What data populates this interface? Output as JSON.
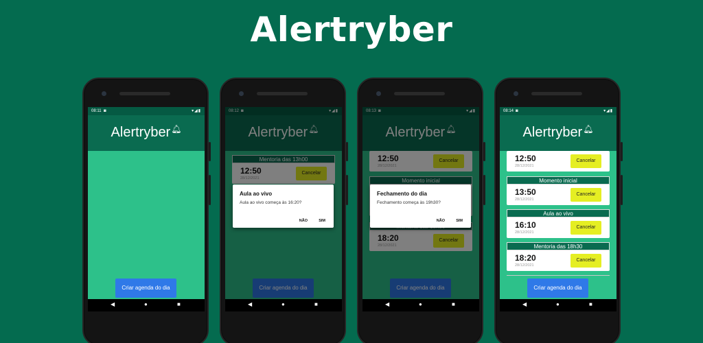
{
  "hero_title": "Alertryber",
  "colors": {
    "background": "#046b4f",
    "app_bar": "#0a6b50",
    "content": "#2dc18a",
    "cancel_button": "#e5ee23",
    "primary_button": "#2f79e8"
  },
  "phones": [
    {
      "status_time": "08:11",
      "app_title": "Alertryber",
      "create_button": "Criar agenda do dia"
    },
    {
      "status_time": "08:12",
      "app_title": "Alertryber",
      "cards": [
        {
          "header": "Mentoria das 13h00",
          "time": "12:50",
          "date": "28/12/2021",
          "cancel": "Cancelar"
        }
      ],
      "dialog": {
        "title": "Aula ao vivo",
        "message": "Aula ao vivo começa às 16:20?",
        "no": "NÃO",
        "yes": "SIM"
      },
      "create_button": "Criar agenda do dia"
    },
    {
      "status_time": "08:13",
      "app_title": "Alertryber",
      "cards": [
        {
          "time": "12:50",
          "date": "28/12/2021",
          "cancel": "Cancelar"
        },
        {
          "header": "Momento inicial"
        },
        {
          "header": "Mentoria das 18h30",
          "time": "18:20",
          "date": "28/12/2021",
          "cancel": "Cancelar"
        }
      ],
      "dialog": {
        "title": "Fechamento do dia",
        "message": "Fechamento começa às 19h30?",
        "no": "NÃO",
        "yes": "SIM"
      },
      "create_button": "Criar agenda do dia"
    },
    {
      "status_time": "08:14",
      "app_title": "Alertryber",
      "cards": [
        {
          "time": "12:50",
          "date": "28/12/2021",
          "cancel": "Cancelar"
        },
        {
          "header": "Momento inicial",
          "time": "13:50",
          "date": "28/12/2021",
          "cancel": "Cancelar"
        },
        {
          "header": "Aula ao vivo",
          "time": "16:10",
          "date": "28/12/2021",
          "cancel": "Cancelar"
        },
        {
          "header": "Mentoria das 18h30",
          "time": "18:20",
          "date": "28/12/2021",
          "cancel": "Cancelar"
        }
      ],
      "create_button": "Criar agenda do dia"
    }
  ]
}
